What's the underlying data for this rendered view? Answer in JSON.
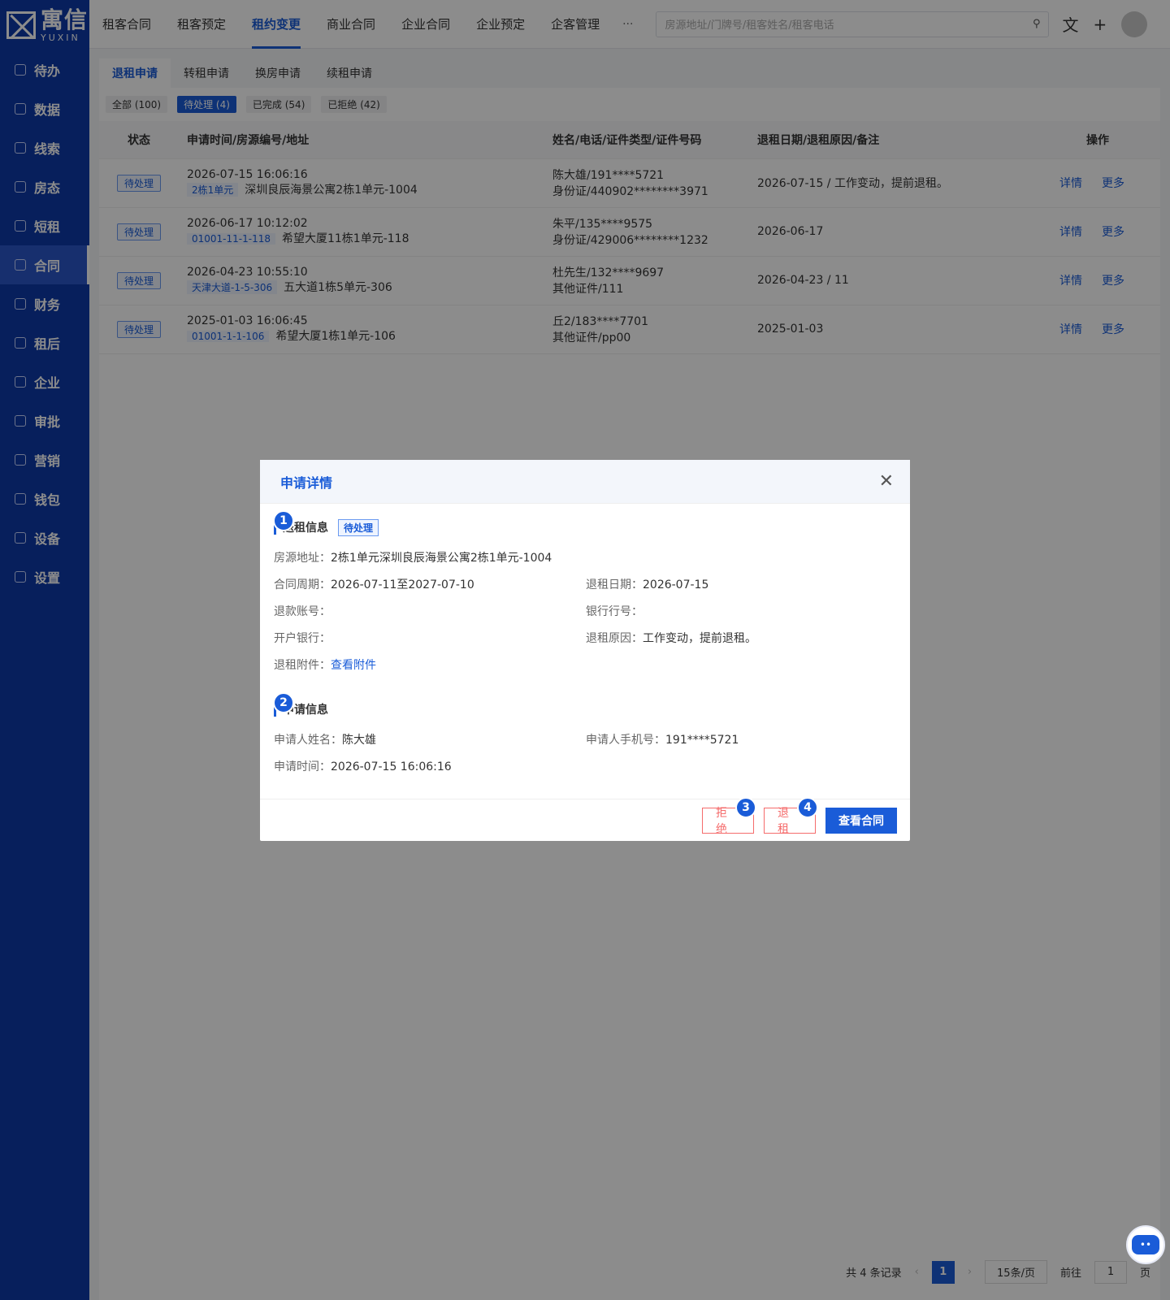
{
  "logo": {
    "cn": "寓信",
    "en": "YUXIN"
  },
  "sidebar": {
    "items": [
      {
        "label": "待办"
      },
      {
        "label": "数据"
      },
      {
        "label": "线索"
      },
      {
        "label": "房态"
      },
      {
        "label": "短租"
      },
      {
        "label": "合同"
      },
      {
        "label": "财务"
      },
      {
        "label": "租后"
      },
      {
        "label": "企业"
      },
      {
        "label": "审批"
      },
      {
        "label": "营销"
      },
      {
        "label": "钱包"
      },
      {
        "label": "设备"
      },
      {
        "label": "设置"
      }
    ],
    "active": "合同"
  },
  "topbar": {
    "tabs": [
      "租客合同",
      "租客预定",
      "租约变更",
      "商业合同",
      "企业合同",
      "企业预定",
      "企客管理"
    ],
    "active": "租约变更",
    "more": "···",
    "search_placeholder": "房源地址/门牌号/租客姓名/租客电话"
  },
  "subtabs": [
    "退租申请",
    "转租申请",
    "换房申请",
    "续租申请"
  ],
  "filters": [
    "全部 (100)",
    "待处理 (4)",
    "已完成 (54)",
    "已拒绝 (42)"
  ],
  "table": {
    "headers": [
      "状态",
      "申请时间/房源编号/地址",
      "姓名/电话/证件类型/证件号码",
      "退租日期/退租原因/备注",
      "操作"
    ],
    "rows": [
      {
        "status": "待处理",
        "time": "2026-07-15 16:06:16",
        "code": "2栋1单元",
        "addr": "深圳良辰海景公寓2栋1单元-1004",
        "name": "陈大雄/191****5721",
        "id": "身份证/440902********3971",
        "reason": "2026-07-15 / 工作变动，提前退租。",
        "op1": "详情",
        "op2": "更多"
      },
      {
        "status": "待处理",
        "time": "2026-06-17 10:12:02",
        "code": "01001-11-1-118",
        "addr": "希望大厦11栋1单元-118",
        "name": "朱平/135****9575",
        "id": "身份证/429006********1232",
        "reason": "2026-06-17",
        "op1": "详情",
        "op2": "更多"
      },
      {
        "status": "待处理",
        "time": "2026-04-23 10:55:10",
        "code": "天津大道-1-5-306",
        "addr": "五大道1栋5单元-306",
        "name": "杜先生/132****9697",
        "id": "其他证件/111",
        "reason": "2026-04-23 / 11",
        "op1": "详情",
        "op2": "更多"
      },
      {
        "status": "待处理",
        "time": "2025-01-03 16:06:45",
        "code": "01001-1-1-106",
        "addr": "希望大厦1栋1单元-106",
        "name": "丘2/183****7701",
        "id": "其他证件/pp00",
        "reason": "2025-01-03",
        "op1": "详情",
        "op2": "更多"
      }
    ]
  },
  "pager": {
    "total": "共 4 条记录",
    "page": "1",
    "size": "15条/页",
    "goto": "前往",
    "unit": "页",
    "input": "1"
  },
  "modal": {
    "title": "申请详情",
    "sec1": {
      "title": "退租信息",
      "tag": "待处理",
      "badge": "1"
    },
    "fields1": {
      "addr_k": "房源地址：",
      "addr_v": "2栋1单元深圳良辰海景公寓2栋1单元-1004",
      "period_k": "合同周期：",
      "period_v": "2026-07-11至2027-07-10",
      "date_k": "退租日期：",
      "date_v": "2026-07-15",
      "acct_k": "退款账号：",
      "acct_v": "",
      "bankno_k": "银行行号：",
      "bankno_v": "",
      "bank_k": "开户银行：",
      "bank_v": "",
      "reason_k": "退租原因：",
      "reason_v": "工作变动，提前退租。",
      "attach_k": "退租附件：",
      "attach_v": "查看附件"
    },
    "sec2": {
      "title": "申请信息",
      "badge": "2"
    },
    "fields2": {
      "name_k": "申请人姓名：",
      "name_v": "陈大雄",
      "phone_k": "申请人手机号：",
      "phone_v": "191****5721",
      "time_k": "申请时间：",
      "time_v": "2026-07-15 16:06:16"
    },
    "buttons": {
      "reject": "拒 绝",
      "reject_badge": "3",
      "checkout": "退 租",
      "checkout_badge": "4",
      "view": "查看合同"
    }
  },
  "colors": {
    "primary": "#1a5cd8",
    "sidebar": "#0e3aa8",
    "danger": "#f56c6c"
  }
}
